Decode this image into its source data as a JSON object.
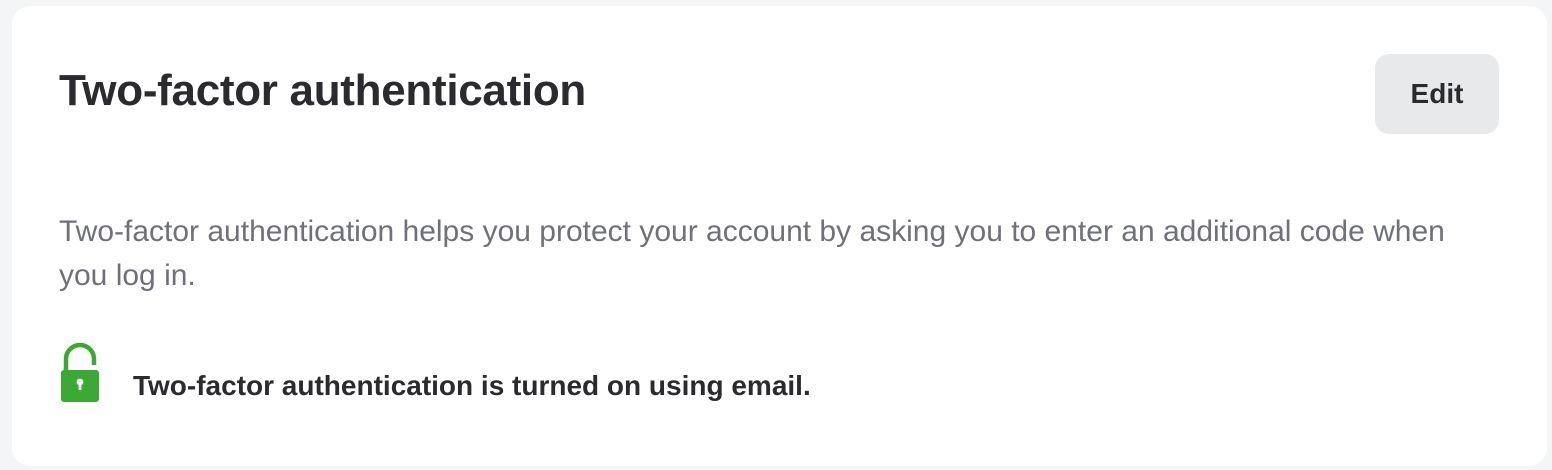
{
  "card": {
    "title": "Two-factor authentication",
    "edit_label": "Edit",
    "description": "Two-factor authentication helps you protect your account by asking you to enter an additional code when you log in.",
    "status": {
      "icon": "unlocked-padlock-icon",
      "icon_color": "#3aaa35",
      "text": "Two-factor authentication is turned on using email."
    }
  }
}
